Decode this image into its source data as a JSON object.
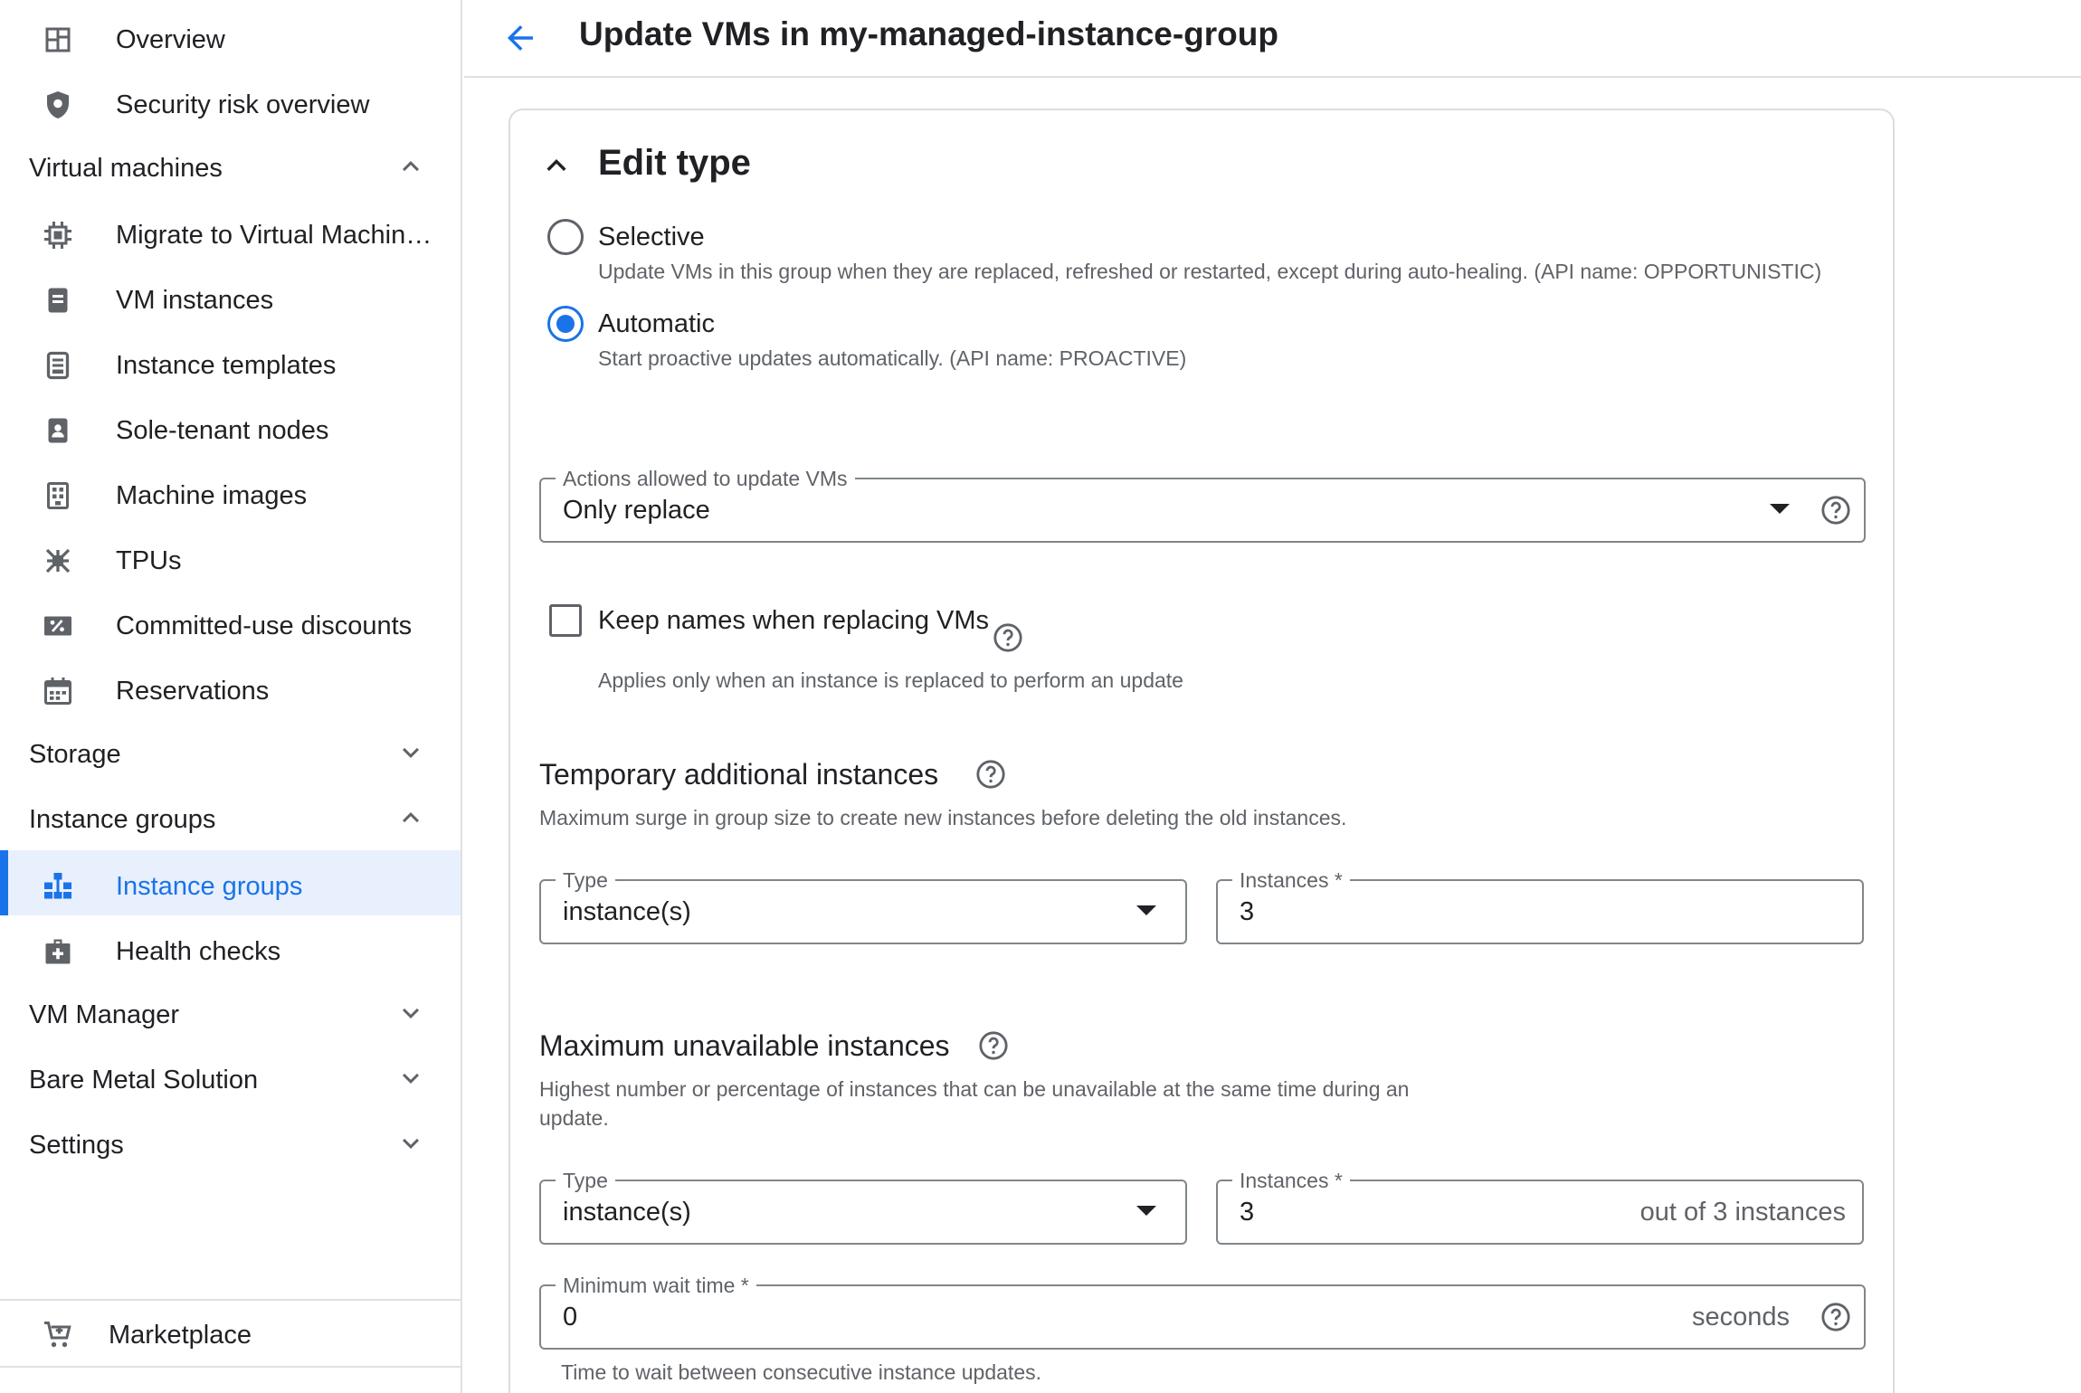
{
  "header": {
    "title": "Update VMs in my-managed-instance-group"
  },
  "sidebar": {
    "top_items": [
      {
        "label": "Overview",
        "icon": "dashboard-icon"
      },
      {
        "label": "Security risk overview",
        "icon": "shield-icon"
      }
    ],
    "sections": {
      "virtual_machines": "Virtual machines",
      "storage": "Storage",
      "instance_groups": "Instance groups",
      "vm_manager": "VM Manager",
      "bare_metal": "Bare Metal Solution",
      "settings": "Settings"
    },
    "vm_items": [
      {
        "label": "Migrate to Virtual Machin…",
        "icon": "migrate-icon"
      },
      {
        "label": "VM instances",
        "icon": "vm-icon"
      },
      {
        "label": "Instance templates",
        "icon": "template-icon"
      },
      {
        "label": "Sole-tenant nodes",
        "icon": "sole-tenant-icon"
      },
      {
        "label": "Machine images",
        "icon": "machine-image-icon"
      },
      {
        "label": "TPUs",
        "icon": "tpu-icon"
      },
      {
        "label": "Committed-use discounts",
        "icon": "percent-icon"
      },
      {
        "label": "Reservations",
        "icon": "calendar-icon"
      }
    ],
    "ig_items": [
      {
        "label": "Instance groups",
        "icon": "instance-groups-icon",
        "active": true
      },
      {
        "label": "Health checks",
        "icon": "health-check-icon"
      }
    ],
    "bottom_items": [
      {
        "label": "Marketplace",
        "icon": "cart-icon"
      }
    ]
  },
  "card": {
    "title": "Edit type",
    "options": [
      {
        "label": "Selective",
        "desc": "Update VMs in this group when they are replaced, refreshed or restarted, except during auto-healing. (API name: OPPORTUNISTIC)",
        "checked": false
      },
      {
        "label": "Automatic",
        "desc": "Start proactive updates automatically. (API name: PROACTIVE)",
        "checked": true
      }
    ],
    "actions_field": {
      "label": "Actions allowed to update VMs",
      "value": "Only replace"
    },
    "keep_names": {
      "label": "Keep names when replacing VMs",
      "desc": "Applies only when an instance is replaced to perform an update",
      "checked": false
    },
    "surge": {
      "title": "Temporary additional instances",
      "desc": "Maximum surge in group size to create new instances before deleting the old instances.",
      "type_label": "Type",
      "type_value": "instance(s)",
      "instances_label": "Instances *",
      "instances_value": "3"
    },
    "unavailable": {
      "title": "Maximum unavailable instances",
      "desc": "Highest number or percentage of instances that can be unavailable at the same time during an update.",
      "type_label": "Type",
      "type_value": "instance(s)",
      "instances_label": "Instances *",
      "instances_value": "3",
      "instances_suffix": "out of 3 instances"
    },
    "wait": {
      "label": "Minimum wait time *",
      "value": "0",
      "suffix": "seconds",
      "desc": "Time to wait between consecutive instance updates."
    }
  },
  "colors": {
    "accent": "#1a73e8",
    "active_bg": "#e8f0fe",
    "text": "#202124",
    "muted": "#5f6368"
  }
}
